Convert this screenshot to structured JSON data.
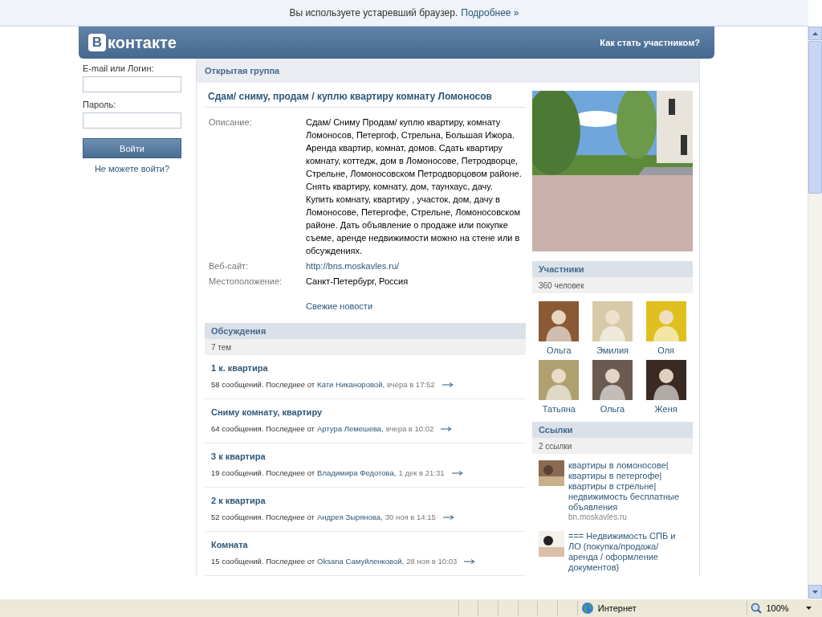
{
  "info_bar": {
    "text": "Вы используете устаревший браузер.",
    "link": "Подробнее »"
  },
  "header": {
    "logo_letter": "В",
    "logo_text": "контакте",
    "join_link": "Как стать участником?"
  },
  "login": {
    "email_label": "E-mail или Логин:",
    "password_label": "Пароль:",
    "button": "Войти",
    "forgot_link": "Не можете войти?"
  },
  "group": {
    "type_label": "Открытая группа",
    "title": "Сдам/ сниму, продам / куплю квартиру комнату Ломоносов",
    "info": [
      {
        "label": "Описание:",
        "value": "Сдам/ Сниму Продам/ куплю квартиру, комнату Ломоносов, Петергоф, Стрельна, Большая Ижора. Аренда квартир, комнат, домов. Сдать квартиру комнату, коттедж, дом в Ломоносове, Петродворце, Стрельне, Ломоносовском Петродворцовом районе. Снять квартиру, комнату, дом, таунхаус, дачу.\nКупить комнату, квартиру , участок, дом, дачу в Ломоносове, Петергофе, Стрельне, Ломоносовском районе. Дать объявление о продаже или покупке съеме, аренде недвижимости можно на стене или в обсуждениях.",
        "kind": "text"
      },
      {
        "label": "Веб-сайт:",
        "value": "http://bns.moskavles.ru/",
        "kind": "link"
      },
      {
        "label": "Местоположение:",
        "value": "Санкт-Петербург, Россия",
        "kind": "text"
      }
    ],
    "news_link": "Свежие новости"
  },
  "discussions": {
    "title": "Обсуждения",
    "count": "7 тем",
    "topics": [
      {
        "title": "1 к. квартира",
        "meta": "58 сообщений. Последнее от",
        "author": "Кати Никаноровой,",
        "time": "вчера в 17:52"
      },
      {
        "title": "Сниму комнату, квартиру",
        "meta": "64 сообщения. Последнее от",
        "author": "Артура Лемешева,",
        "time": "вчера в 10:02"
      },
      {
        "title": "3 к квартира",
        "meta": "19 сообщений. Последнее от",
        "author": "Владимира Федотова,",
        "time": "1 дек в 21:31"
      },
      {
        "title": "2 к квартира",
        "meta": "52 сообщения. Последнее от",
        "author": "Андрея Зырянова,",
        "time": "30 ноя в 14:15"
      },
      {
        "title": "Комната",
        "meta": "15 сообщений. Последнее от",
        "author": "Oksana Самуйленковой,",
        "time": "28 ноя в 10:03"
      }
    ]
  },
  "members": {
    "title": "Участники",
    "count": "360 человек",
    "people": [
      {
        "name": "Ольга",
        "color": "#8a5a34"
      },
      {
        "name": "Эмилия",
        "color": "#d8c9a8"
      },
      {
        "name": "Оля",
        "color": "#e0c020"
      },
      {
        "name": "Татьяна",
        "color": "#b0a070"
      },
      {
        "name": "Ольга",
        "color": "#6a5a50"
      },
      {
        "name": "Женя",
        "color": "#3a2a22"
      }
    ]
  },
  "links": {
    "title": "Ссылки",
    "count": "2 ссылки",
    "items": [
      {
        "title": "квартиры в ломоносове|квартиры в петергофе|квартиры в стрельне|недвижимость бесплатные объявления",
        "url": "bn.moskavles.ru"
      },
      {
        "title": "=== Недвижимость СПБ и ЛО (покупка/продажа/аренда / оформление документов)"
      }
    ]
  },
  "status_bar": {
    "zone": "Интернет",
    "zoom": "100%"
  }
}
